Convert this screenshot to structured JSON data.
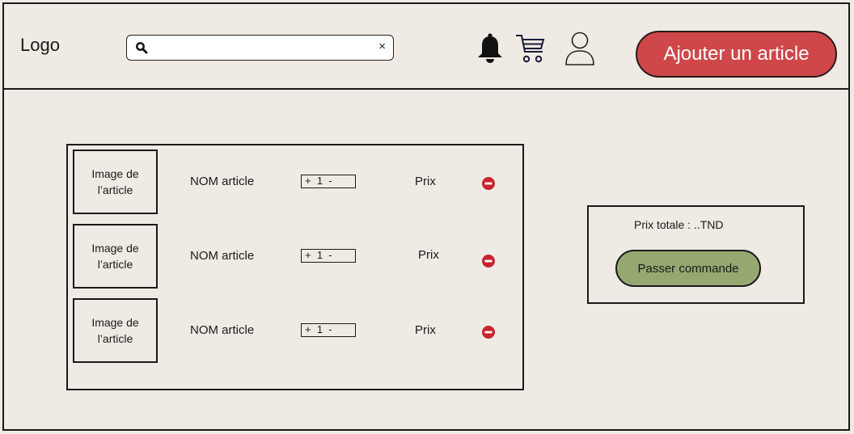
{
  "header": {
    "logo": "Logo",
    "search": {
      "value": "",
      "placeholder": "",
      "clear_icon": "×"
    },
    "icons": [
      "bell-icon",
      "cart-icon",
      "user-icon"
    ],
    "add_button": "Ajouter un article"
  },
  "cart": {
    "items": [
      {
        "image_label": "Image de l’article",
        "name": "NOM article",
        "stepper": "+  1  -",
        "price": "Prix"
      },
      {
        "image_label": "Image de l’article",
        "name": "NOM article",
        "stepper": "+  1  -",
        "price": "Prix"
      },
      {
        "image_label": "Image de l’article",
        "name": "NOM article",
        "stepper": "+  1  -",
        "price": "Prix"
      }
    ]
  },
  "summary": {
    "total": "Prix totale : ..TND",
    "order_button": "Passer commande"
  },
  "colors": {
    "background": "#efebe4",
    "add_button": "#cf4749",
    "order_button": "#95a872",
    "remove_icon": "#c8242f"
  }
}
